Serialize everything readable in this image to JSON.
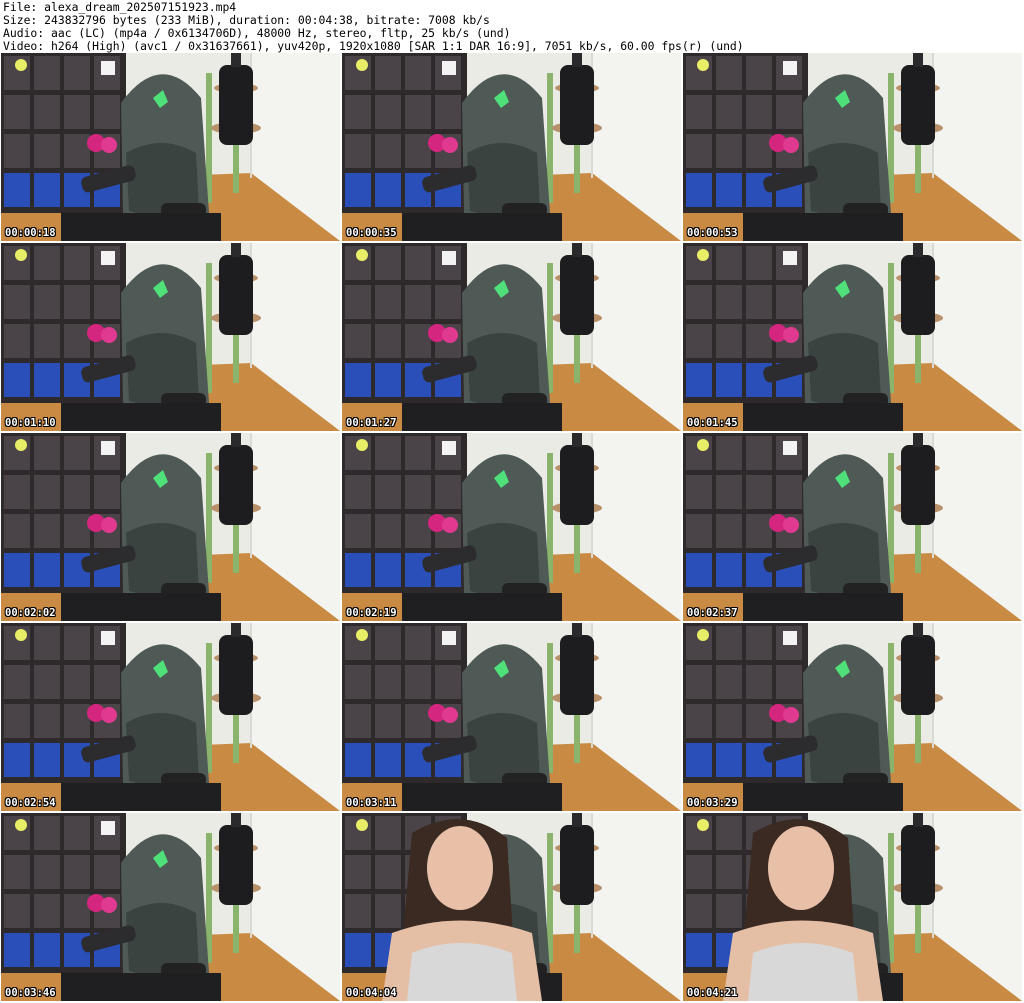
{
  "header": {
    "file_line": "File: alexa_dream_202507151923.mp4",
    "size_line": "Size: 243832796 bytes (233 MiB), duration: 00:04:38, bitrate: 7008 kb/s",
    "audio_line": "Audio: aac (LC) (mp4a / 0x6134706D), 48000 Hz, stereo, fltp, 25 kb/s (und)",
    "video_line": "Video: h264 (High) (avc1 / 0x31637661), yuv420p, 1920x1080 [SAR 1:1 DAR 16:9], 7051 kb/s, 60.00 fps(r) (und)"
  },
  "thumbnails": [
    {
      "timestamp": "00:00:18",
      "scene": "empty-chair"
    },
    {
      "timestamp": "00:00:35",
      "scene": "empty-chair"
    },
    {
      "timestamp": "00:00:53",
      "scene": "empty-chair"
    },
    {
      "timestamp": "00:01:10",
      "scene": "empty-chair"
    },
    {
      "timestamp": "00:01:27",
      "scene": "empty-chair"
    },
    {
      "timestamp": "00:01:45",
      "scene": "empty-chair"
    },
    {
      "timestamp": "00:02:02",
      "scene": "empty-chair"
    },
    {
      "timestamp": "00:02:19",
      "scene": "empty-chair"
    },
    {
      "timestamp": "00:02:37",
      "scene": "empty-chair"
    },
    {
      "timestamp": "00:02:54",
      "scene": "empty-chair"
    },
    {
      "timestamp": "00:03:11",
      "scene": "empty-chair"
    },
    {
      "timestamp": "00:03:29",
      "scene": "empty-chair"
    },
    {
      "timestamp": "00:03:46",
      "scene": "empty-chair"
    },
    {
      "timestamp": "00:04:04",
      "scene": "person-seated"
    },
    {
      "timestamp": "00:04:21",
      "scene": "person-seated"
    }
  ],
  "colors": {
    "floor": "#c98a44",
    "wall": "#e9ebe4",
    "chair": "#4f5a57",
    "logo": "#4fe07a",
    "shelf": "#2e2a2c",
    "plant_stand": "#8ab36c"
  }
}
